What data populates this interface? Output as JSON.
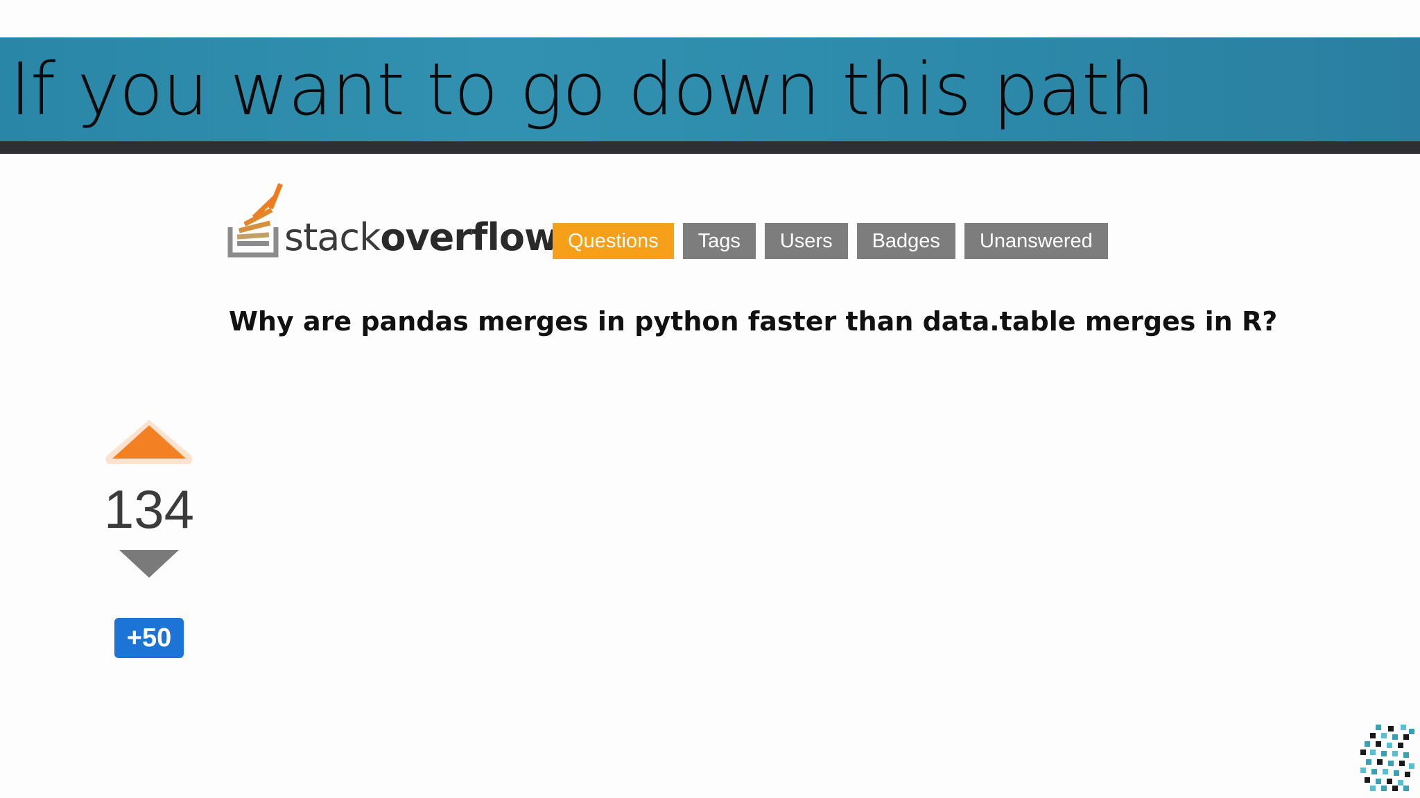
{
  "slide": {
    "title": "If you want to go down this path"
  },
  "logo": {
    "wordmark_light": "stack",
    "wordmark_bold": "overflow",
    "icon": "stackoverflow-logo-icon"
  },
  "nav": {
    "tabs": [
      {
        "label": "Questions",
        "active": true
      },
      {
        "label": "Tags",
        "active": false
      },
      {
        "label": "Users",
        "active": false
      },
      {
        "label": "Badges",
        "active": false
      },
      {
        "label": "Unanswered",
        "active": false
      }
    ]
  },
  "question": {
    "title": "Why are pandas merges in python faster than data.table merges in R?"
  },
  "votes": {
    "count": "134",
    "upvote_icon": "upvote-arrow-icon",
    "downvote_icon": "downvote-arrow-icon",
    "bounty": "+50"
  },
  "colors": {
    "header_bg": "#2f8cad",
    "header_band": "#2d2f33",
    "active_tab": "#f6a01a",
    "inactive_tab": "#7d7d7d",
    "upvote": "#f48024",
    "downvote": "#7a7a7a",
    "bounty_bg": "#1c74d6"
  }
}
